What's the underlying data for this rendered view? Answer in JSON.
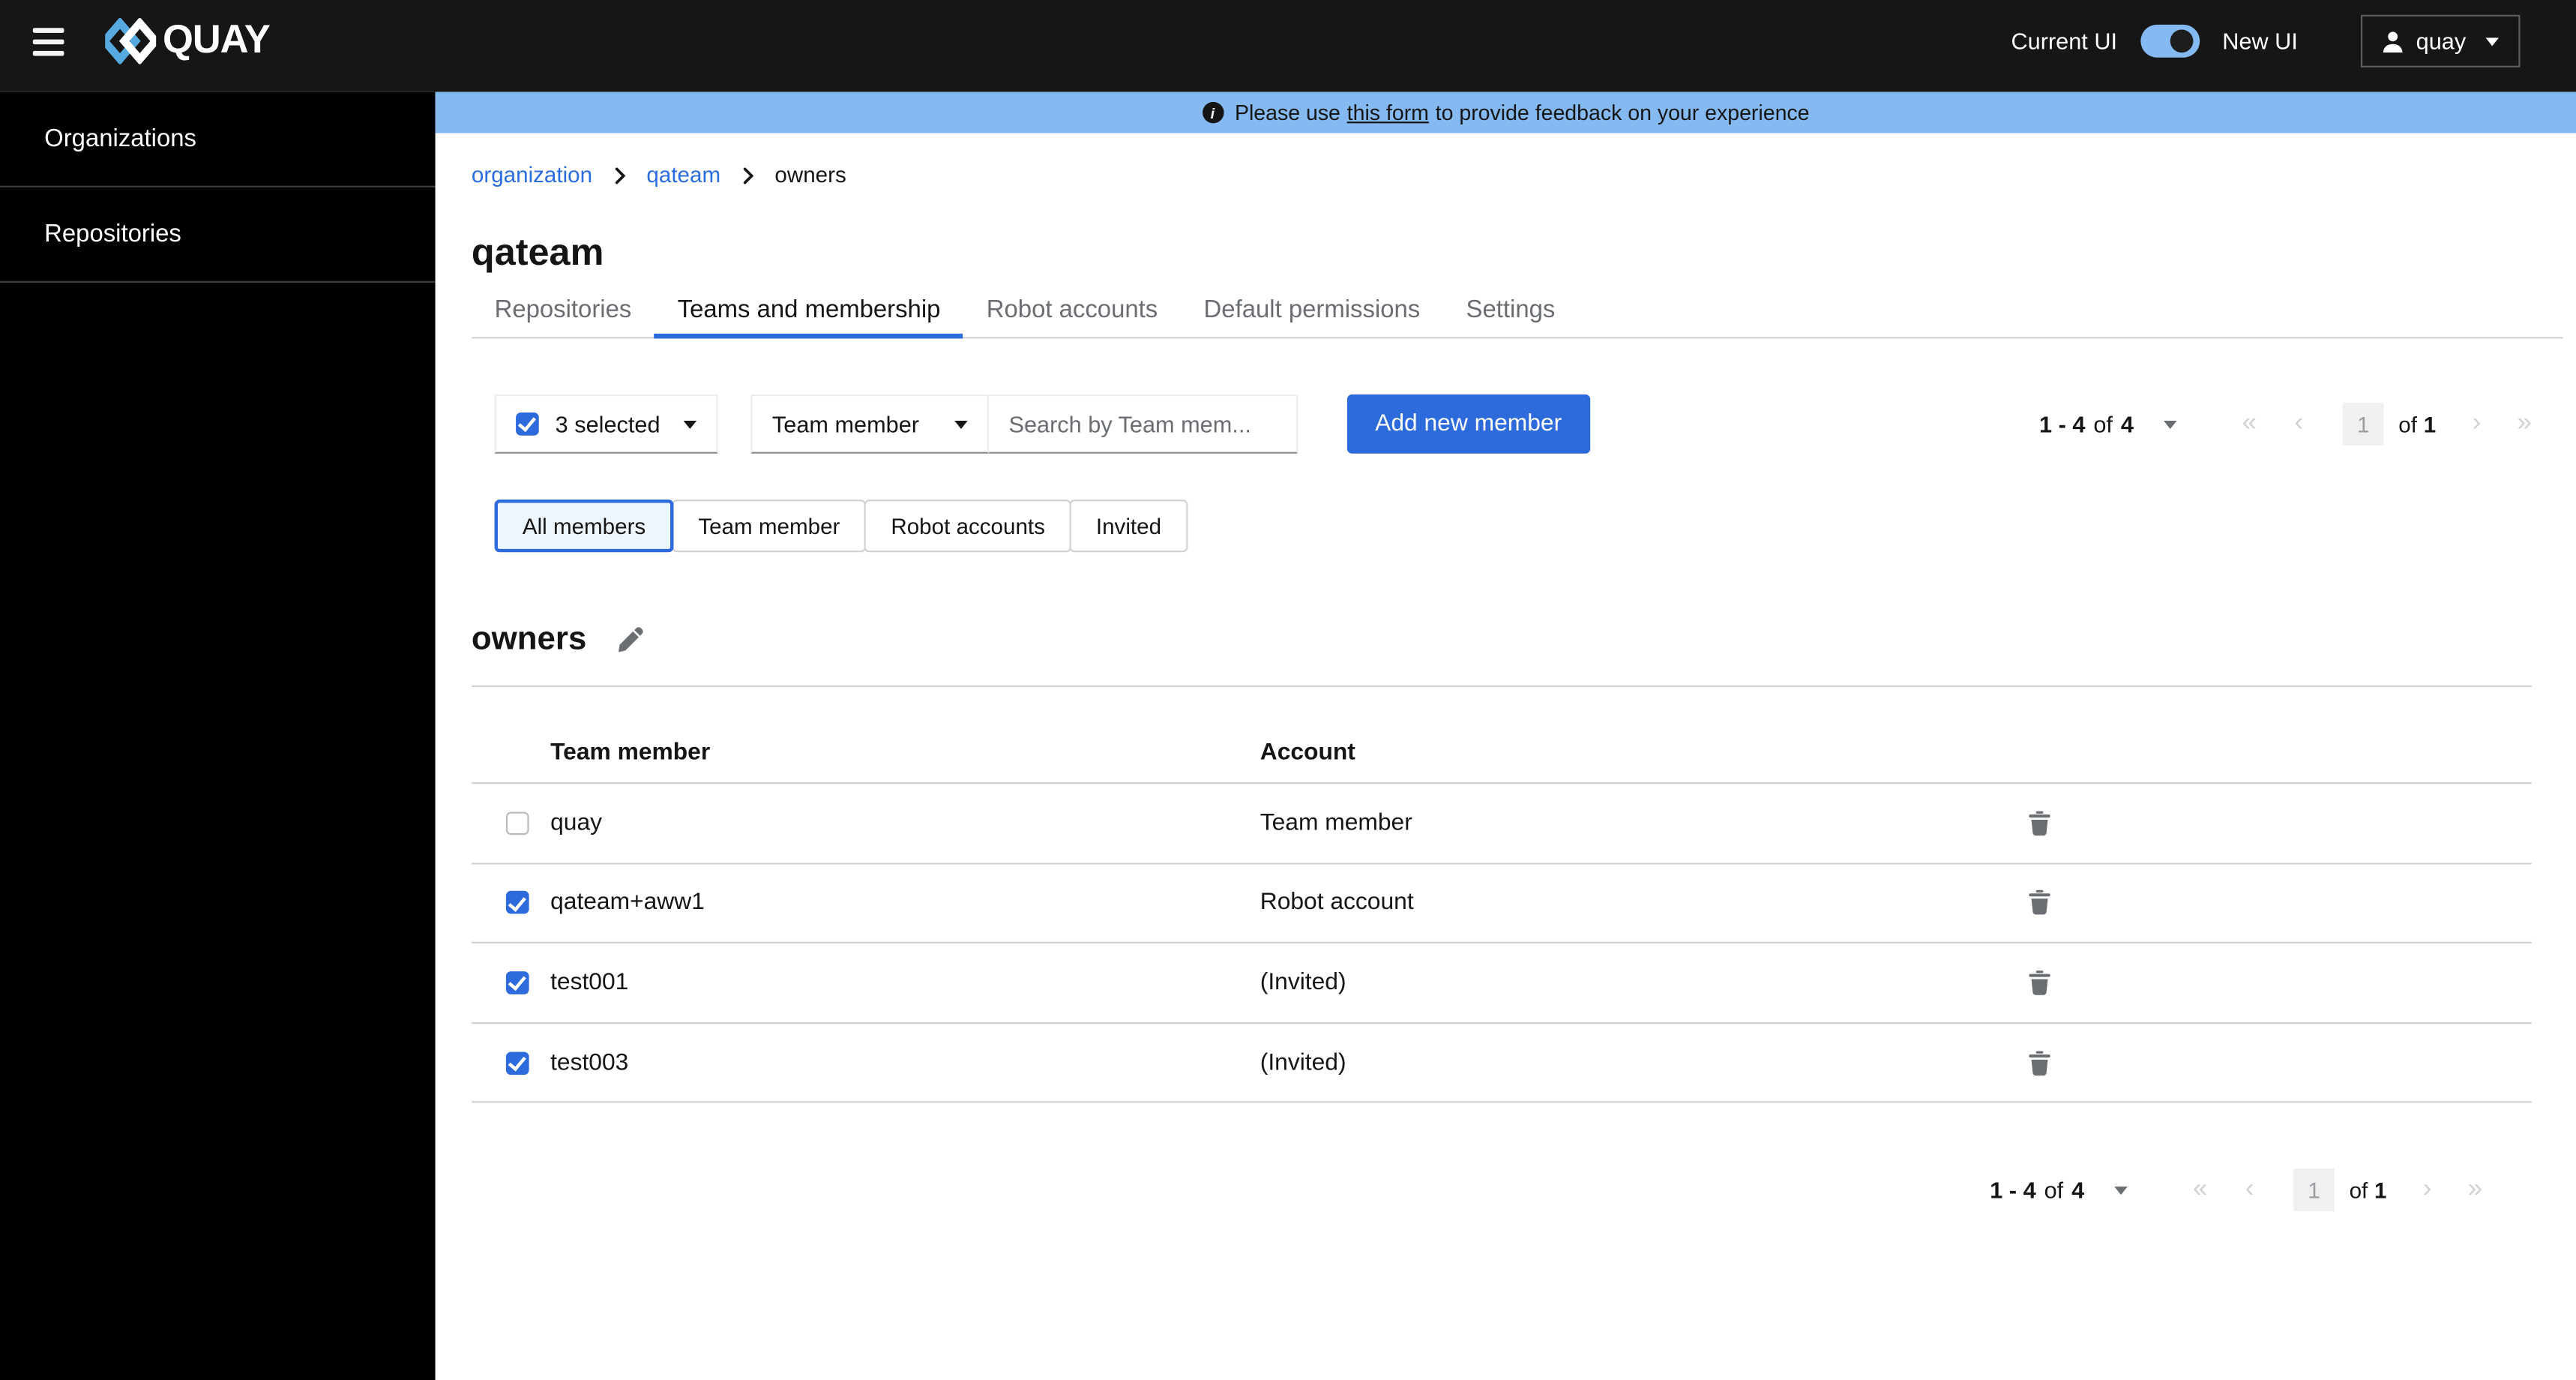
{
  "masthead": {
    "brand": "QUAY",
    "current_ui_label": "Current UI",
    "new_ui_label": "New UI",
    "user": "quay"
  },
  "banner": {
    "text_before": "Please use",
    "link_text": "this form",
    "text_after": "to provide feedback on your experience"
  },
  "sidebar": {
    "items": [
      {
        "label": "Organizations"
      },
      {
        "label": "Repositories"
      }
    ]
  },
  "breadcrumb": {
    "items": [
      "organization",
      "qateam",
      "owners"
    ]
  },
  "page": {
    "title": "qateam"
  },
  "tabs": [
    {
      "label": "Repositories",
      "active": false
    },
    {
      "label": "Teams and membership",
      "active": true
    },
    {
      "label": "Robot accounts",
      "active": false
    },
    {
      "label": "Default permissions",
      "active": false
    },
    {
      "label": "Settings",
      "active": false
    }
  ],
  "toolbar": {
    "bulk": {
      "label": "3 selected",
      "checked": true
    },
    "kind_filter": {
      "label": "Team member"
    },
    "search_placeholder": "Search by Team mem...",
    "add_button_label": "Add new member"
  },
  "filters": [
    {
      "label": "All members",
      "active": true
    },
    {
      "label": "Team member",
      "active": false
    },
    {
      "label": "Robot accounts",
      "active": false
    },
    {
      "label": "Invited",
      "active": false
    }
  ],
  "team": {
    "name": "owners"
  },
  "table": {
    "columns": [
      "Team member",
      "Account"
    ],
    "rows": [
      {
        "name": "quay",
        "account": "Team member",
        "checked": false
      },
      {
        "name": "qateam+aww1",
        "account": "Robot account",
        "checked": true
      },
      {
        "name": "test001",
        "account": "(Invited)",
        "checked": true
      },
      {
        "name": "test003",
        "account": "(Invited)",
        "checked": true
      }
    ]
  },
  "pagination": {
    "range": "1 - 4",
    "of_word": "of",
    "total": "4",
    "current_page": "1",
    "of_pages_word": "of",
    "total_pages": "1",
    "glyphs": {
      "first": "«",
      "prev": "‹",
      "next": "›",
      "last": "»"
    }
  },
  "colors": {
    "primary_blue": "#2d6bdd",
    "link_blue": "#2b6de0",
    "banner_blue": "#85b9f1",
    "masthead_black": "#161616",
    "sidebar_black": "#000000",
    "logo_blue": "#57aadf",
    "muted_gray": "#6a6e73",
    "border_gray": "#d2d2d2",
    "disabled_gray": "#d2d2d2"
  }
}
